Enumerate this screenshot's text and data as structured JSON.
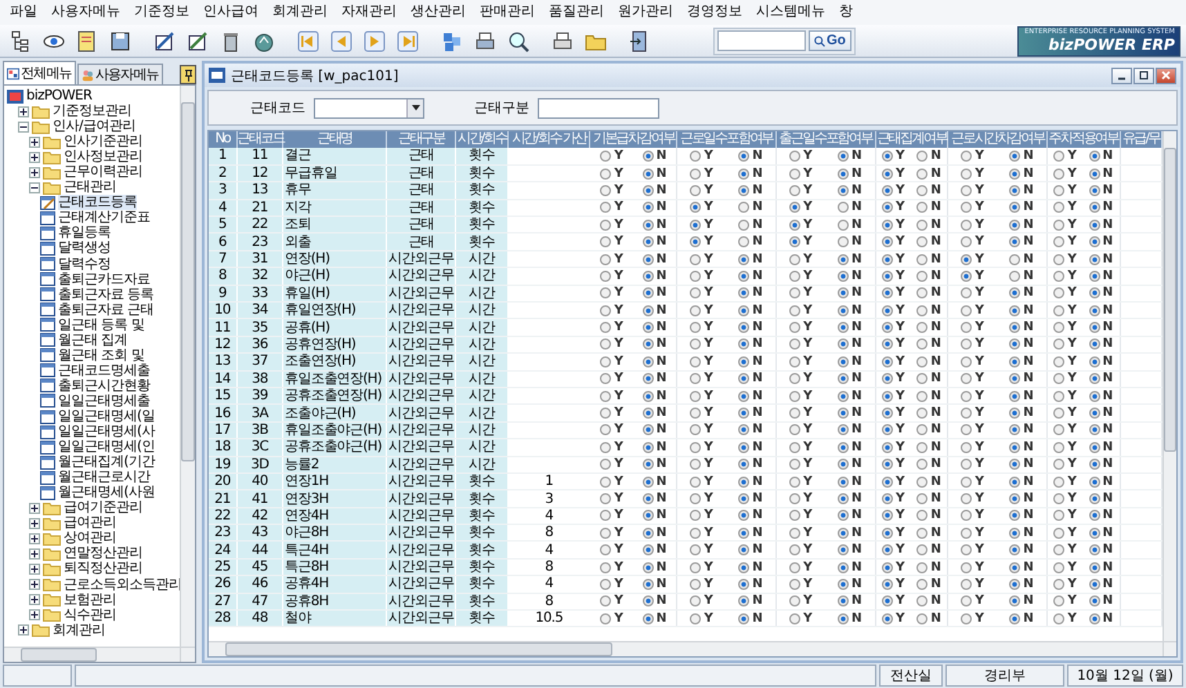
{
  "menu_bar": [
    "파일",
    "사용자메뉴",
    "기준정보",
    "인사급여",
    "회계관리",
    "자재관리",
    "생산관리",
    "판매관리",
    "품질관리",
    "원가관리",
    "경영정보",
    "시스템메뉴",
    "창"
  ],
  "toolbar": {
    "search": {
      "button": "Go"
    },
    "logo": {
      "tagline": "ENTERPRISE RESOURCE PLANNING SYSTEM",
      "name": "bizPOWER ERP"
    }
  },
  "sidebar": {
    "tabs": [
      {
        "label": "전체메뉴",
        "selected": true
      },
      {
        "label": "사용자메뉴",
        "selected": false
      }
    ],
    "tree": [
      {
        "label": "bizPOWER",
        "kind": "root",
        "selected": false,
        "children": [
          {
            "label": "기준정보관리",
            "kind": "folder",
            "expanded": false,
            "selected": false
          },
          {
            "label": "인사/급여관리",
            "kind": "folder",
            "expanded": true,
            "selected": false,
            "children": [
              {
                "label": "인사기준관리",
                "kind": "folder",
                "expanded": false,
                "selected": false
              },
              {
                "label": "인사정보관리",
                "kind": "folder",
                "expanded": false,
                "selected": false
              },
              {
                "label": "근무이력관리",
                "kind": "folder",
                "expanded": false,
                "selected": false
              },
              {
                "label": "근태관리",
                "kind": "folder",
                "expanded": true,
                "selected": false,
                "children": [
                  {
                    "label": "근태코드등록",
                    "kind": "form-edit",
                    "selected": true
                  },
                  {
                    "label": "근태계산기준표",
                    "kind": "form",
                    "selected": false
                  },
                  {
                    "label": "휴일등록",
                    "kind": "form",
                    "selected": false
                  },
                  {
                    "label": "달력생성",
                    "kind": "form",
                    "selected": false
                  },
                  {
                    "label": "달력수정",
                    "kind": "form",
                    "selected": false
                  },
                  {
                    "label": "출퇴근카드자료",
                    "kind": "form",
                    "selected": false
                  },
                  {
                    "label": "출퇴근자료 등록",
                    "kind": "form",
                    "selected": false
                  },
                  {
                    "label": "출퇴근자료 근태",
                    "kind": "form",
                    "selected": false
                  },
                  {
                    "label": "일근태 등록 및",
                    "kind": "form",
                    "selected": false
                  },
                  {
                    "label": "월근태 집계",
                    "kind": "form",
                    "selected": false
                  },
                  {
                    "label": "월근태 조회 및",
                    "kind": "form",
                    "selected": false
                  },
                  {
                    "label": "근태코드명세출",
                    "kind": "form",
                    "selected": false
                  },
                  {
                    "label": "출퇴근시간현황",
                    "kind": "form",
                    "selected": false
                  },
                  {
                    "label": "일일근태명세출",
                    "kind": "form",
                    "selected": false
                  },
                  {
                    "label": "일일근태명세(일",
                    "kind": "form",
                    "selected": false
                  },
                  {
                    "label": "일일근태명세(사",
                    "kind": "form",
                    "selected": false
                  },
                  {
                    "label": "일일근태명세(인",
                    "kind": "form",
                    "selected": false
                  },
                  {
                    "label": "월근태집계(기간",
                    "kind": "form",
                    "selected": false
                  },
                  {
                    "label": "월근태근로시간",
                    "kind": "form",
                    "selected": false
                  },
                  {
                    "label": "월근태명세(사원",
                    "kind": "form",
                    "selected": false
                  }
                ]
              },
              {
                "label": "급여기준관리",
                "kind": "folder",
                "expanded": false,
                "selected": false
              },
              {
                "label": "급여관리",
                "kind": "folder",
                "expanded": false,
                "selected": false
              },
              {
                "label": "상여관리",
                "kind": "folder",
                "expanded": false,
                "selected": false
              },
              {
                "label": "연말정산관리",
                "kind": "folder",
                "expanded": false,
                "selected": false
              },
              {
                "label": "퇴직정산관리",
                "kind": "folder",
                "expanded": false,
                "selected": false
              },
              {
                "label": "근로소득외소득관리",
                "kind": "folder",
                "expanded": false,
                "selected": false
              },
              {
                "label": "보험관리",
                "kind": "folder",
                "expanded": false,
                "selected": false
              },
              {
                "label": "식수관리",
                "kind": "folder",
                "expanded": false,
                "selected": false
              }
            ]
          },
          {
            "label": "회계관리",
            "kind": "folder",
            "expanded": false,
            "selected": false
          }
        ]
      }
    ]
  },
  "window": {
    "title": "근태코드등록 [w_pac101]",
    "filters": [
      {
        "label": "근태코드",
        "kind": "dropdown"
      },
      {
        "label": "근태구분",
        "kind": "text"
      }
    ],
    "table": {
      "columns": [
        "No",
        "근태코드",
        "근태명",
        "근태구분",
        "시간/회수",
        "시간/회수 가산",
        "기본급차감여부",
        "근로일수포함여부",
        "출근일수포함여부",
        "근태집계여부",
        "근로시간차감여부",
        "주차적용여부",
        "유급/무"
      ],
      "rows": [
        {
          "no": "1",
          "code": "11",
          "name": "결근",
          "type": "근태",
          "unit": "횟수",
          "add": "",
          "flags": [
            {
              "y": "Y",
              "n": "N",
              "selected_y": false
            },
            {
              "y": "Y",
              "n": "N",
              "selected_y": false
            },
            {
              "y": "Y",
              "n": "N",
              "selected_y": false
            },
            {
              "y": "Y",
              "n": "N",
              "selected_y": true
            },
            {
              "y": "Y",
              "n": "N",
              "selected_y": false
            },
            {
              "y": "Y",
              "n": "N",
              "selected_y": false
            }
          ]
        },
        {
          "no": "2",
          "code": "12",
          "name": "무급휴일",
          "type": "근태",
          "unit": "횟수",
          "add": "",
          "flags": [
            {
              "y": "Y",
              "n": "N",
              "selected_y": false
            },
            {
              "y": "Y",
              "n": "N",
              "selected_y": false
            },
            {
              "y": "Y",
              "n": "N",
              "selected_y": false
            },
            {
              "y": "Y",
              "n": "N",
              "selected_y": true
            },
            {
              "y": "Y",
              "n": "N",
              "selected_y": false
            },
            {
              "y": "Y",
              "n": "N",
              "selected_y": false
            }
          ]
        },
        {
          "no": "3",
          "code": "13",
          "name": "휴무",
          "type": "근태",
          "unit": "횟수",
          "add": "",
          "flags": [
            {
              "y": "Y",
              "n": "N",
              "selected_y": false
            },
            {
              "y": "Y",
              "n": "N",
              "selected_y": false
            },
            {
              "y": "Y",
              "n": "N",
              "selected_y": false
            },
            {
              "y": "Y",
              "n": "N",
              "selected_y": true
            },
            {
              "y": "Y",
              "n": "N",
              "selected_y": false
            },
            {
              "y": "Y",
              "n": "N",
              "selected_y": false
            }
          ]
        },
        {
          "no": "4",
          "code": "21",
          "name": "지각",
          "type": "근태",
          "unit": "횟수",
          "add": "",
          "flags": [
            {
              "y": "Y",
              "n": "N",
              "selected_y": false
            },
            {
              "y": "Y",
              "n": "N",
              "selected_y": true
            },
            {
              "y": "Y",
              "n": "N",
              "selected_y": true
            },
            {
              "y": "Y",
              "n": "N",
              "selected_y": true
            },
            {
              "y": "Y",
              "n": "N",
              "selected_y": false
            },
            {
              "y": "Y",
              "n": "N",
              "selected_y": false
            }
          ]
        },
        {
          "no": "5",
          "code": "22",
          "name": "조퇴",
          "type": "근태",
          "unit": "횟수",
          "add": "",
          "flags": [
            {
              "y": "Y",
              "n": "N",
              "selected_y": false
            },
            {
              "y": "Y",
              "n": "N",
              "selected_y": true
            },
            {
              "y": "Y",
              "n": "N",
              "selected_y": true
            },
            {
              "y": "Y",
              "n": "N",
              "selected_y": true
            },
            {
              "y": "Y",
              "n": "N",
              "selected_y": false
            },
            {
              "y": "Y",
              "n": "N",
              "selected_y": false
            }
          ]
        },
        {
          "no": "6",
          "code": "23",
          "name": "외출",
          "type": "근태",
          "unit": "횟수",
          "add": "",
          "flags": [
            {
              "y": "Y",
              "n": "N",
              "selected_y": false
            },
            {
              "y": "Y",
              "n": "N",
              "selected_y": true
            },
            {
              "y": "Y",
              "n": "N",
              "selected_y": true
            },
            {
              "y": "Y",
              "n": "N",
              "selected_y": true
            },
            {
              "y": "Y",
              "n": "N",
              "selected_y": false
            },
            {
              "y": "Y",
              "n": "N",
              "selected_y": false
            }
          ]
        },
        {
          "no": "7",
          "code": "31",
          "name": "연장(H)",
          "type": "시간외근무",
          "unit": "시간",
          "add": "",
          "flags": [
            {
              "y": "Y",
              "n": "N",
              "selected_y": false
            },
            {
              "y": "Y",
              "n": "N",
              "selected_y": false
            },
            {
              "y": "Y",
              "n": "N",
              "selected_y": false
            },
            {
              "y": "Y",
              "n": "N",
              "selected_y": true
            },
            {
              "y": "Y",
              "n": "N",
              "selected_y": true
            },
            {
              "y": "Y",
              "n": "N",
              "selected_y": false
            }
          ]
        },
        {
          "no": "8",
          "code": "32",
          "name": "야근(H)",
          "type": "시간외근무",
          "unit": "시간",
          "add": "",
          "flags": [
            {
              "y": "Y",
              "n": "N",
              "selected_y": false
            },
            {
              "y": "Y",
              "n": "N",
              "selected_y": false
            },
            {
              "y": "Y",
              "n": "N",
              "selected_y": false
            },
            {
              "y": "Y",
              "n": "N",
              "selected_y": true
            },
            {
              "y": "Y",
              "n": "N",
              "selected_y": true
            },
            {
              "y": "Y",
              "n": "N",
              "selected_y": false
            }
          ]
        },
        {
          "no": "9",
          "code": "33",
          "name": "휴일(H)",
          "type": "시간외근무",
          "unit": "시간",
          "add": "",
          "flags": [
            {
              "y": "Y",
              "n": "N",
              "selected_y": false
            },
            {
              "y": "Y",
              "n": "N",
              "selected_y": false
            },
            {
              "y": "Y",
              "n": "N",
              "selected_y": false
            },
            {
              "y": "Y",
              "n": "N",
              "selected_y": true
            },
            {
              "y": "Y",
              "n": "N",
              "selected_y": false
            },
            {
              "y": "Y",
              "n": "N",
              "selected_y": false
            }
          ]
        },
        {
          "no": "10",
          "code": "34",
          "name": "휴일연장(H)",
          "type": "시간외근무",
          "unit": "시간",
          "add": "",
          "flags": [
            {
              "y": "Y",
              "n": "N",
              "selected_y": false
            },
            {
              "y": "Y",
              "n": "N",
              "selected_y": false
            },
            {
              "y": "Y",
              "n": "N",
              "selected_y": false
            },
            {
              "y": "Y",
              "n": "N",
              "selected_y": true
            },
            {
              "y": "Y",
              "n": "N",
              "selected_y": false
            },
            {
              "y": "Y",
              "n": "N",
              "selected_y": false
            }
          ]
        },
        {
          "no": "11",
          "code": "35",
          "name": "공휴(H)",
          "type": "시간외근무",
          "unit": "시간",
          "add": "",
          "flags": [
            {
              "y": "Y",
              "n": "N",
              "selected_y": false
            },
            {
              "y": "Y",
              "n": "N",
              "selected_y": false
            },
            {
              "y": "Y",
              "n": "N",
              "selected_y": false
            },
            {
              "y": "Y",
              "n": "N",
              "selected_y": true
            },
            {
              "y": "Y",
              "n": "N",
              "selected_y": false
            },
            {
              "y": "Y",
              "n": "N",
              "selected_y": false
            }
          ]
        },
        {
          "no": "12",
          "code": "36",
          "name": "공휴연장(H)",
          "type": "시간외근무",
          "unit": "시간",
          "add": "",
          "flags": [
            {
              "y": "Y",
              "n": "N",
              "selected_y": false
            },
            {
              "y": "Y",
              "n": "N",
              "selected_y": false
            },
            {
              "y": "Y",
              "n": "N",
              "selected_y": false
            },
            {
              "y": "Y",
              "n": "N",
              "selected_y": true
            },
            {
              "y": "Y",
              "n": "N",
              "selected_y": false
            },
            {
              "y": "Y",
              "n": "N",
              "selected_y": false
            }
          ]
        },
        {
          "no": "13",
          "code": "37",
          "name": "조출연장(H)",
          "type": "시간외근무",
          "unit": "시간",
          "add": "",
          "flags": [
            {
              "y": "Y",
              "n": "N",
              "selected_y": false
            },
            {
              "y": "Y",
              "n": "N",
              "selected_y": false
            },
            {
              "y": "Y",
              "n": "N",
              "selected_y": false
            },
            {
              "y": "Y",
              "n": "N",
              "selected_y": true
            },
            {
              "y": "Y",
              "n": "N",
              "selected_y": false
            },
            {
              "y": "Y",
              "n": "N",
              "selected_y": false
            }
          ]
        },
        {
          "no": "14",
          "code": "38",
          "name": "휴일조출연장(H)",
          "type": "시간외근무",
          "unit": "시간",
          "add": "",
          "flags": [
            {
              "y": "Y",
              "n": "N",
              "selected_y": false
            },
            {
              "y": "Y",
              "n": "N",
              "selected_y": false
            },
            {
              "y": "Y",
              "n": "N",
              "selected_y": false
            },
            {
              "y": "Y",
              "n": "N",
              "selected_y": true
            },
            {
              "y": "Y",
              "n": "N",
              "selected_y": false
            },
            {
              "y": "Y",
              "n": "N",
              "selected_y": false
            }
          ]
        },
        {
          "no": "15",
          "code": "39",
          "name": "공휴조출연장(H)",
          "type": "시간외근무",
          "unit": "시간",
          "add": "",
          "flags": [
            {
              "y": "Y",
              "n": "N",
              "selected_y": false
            },
            {
              "y": "Y",
              "n": "N",
              "selected_y": false
            },
            {
              "y": "Y",
              "n": "N",
              "selected_y": false
            },
            {
              "y": "Y",
              "n": "N",
              "selected_y": true
            },
            {
              "y": "Y",
              "n": "N",
              "selected_y": false
            },
            {
              "y": "Y",
              "n": "N",
              "selected_y": false
            }
          ]
        },
        {
          "no": "16",
          "code": "3A",
          "name": "조출야근(H)",
          "type": "시간외근무",
          "unit": "시간",
          "add": "",
          "flags": [
            {
              "y": "Y",
              "n": "N",
              "selected_y": false
            },
            {
              "y": "Y",
              "n": "N",
              "selected_y": false
            },
            {
              "y": "Y",
              "n": "N",
              "selected_y": false
            },
            {
              "y": "Y",
              "n": "N",
              "selected_y": true
            },
            {
              "y": "Y",
              "n": "N",
              "selected_y": false
            },
            {
              "y": "Y",
              "n": "N",
              "selected_y": false
            }
          ]
        },
        {
          "no": "17",
          "code": "3B",
          "name": "휴일조출야근(H)",
          "type": "시간외근무",
          "unit": "시간",
          "add": "",
          "flags": [
            {
              "y": "Y",
              "n": "N",
              "selected_y": false
            },
            {
              "y": "Y",
              "n": "N",
              "selected_y": false
            },
            {
              "y": "Y",
              "n": "N",
              "selected_y": false
            },
            {
              "y": "Y",
              "n": "N",
              "selected_y": true
            },
            {
              "y": "Y",
              "n": "N",
              "selected_y": false
            },
            {
              "y": "Y",
              "n": "N",
              "selected_y": false
            }
          ]
        },
        {
          "no": "18",
          "code": "3C",
          "name": "공휴조출야근(H)",
          "type": "시간외근무",
          "unit": "시간",
          "add": "",
          "flags": [
            {
              "y": "Y",
              "n": "N",
              "selected_y": false
            },
            {
              "y": "Y",
              "n": "N",
              "selected_y": false
            },
            {
              "y": "Y",
              "n": "N",
              "selected_y": false
            },
            {
              "y": "Y",
              "n": "N",
              "selected_y": true
            },
            {
              "y": "Y",
              "n": "N",
              "selected_y": false
            },
            {
              "y": "Y",
              "n": "N",
              "selected_y": false
            }
          ]
        },
        {
          "no": "19",
          "code": "3D",
          "name": "능률2",
          "type": "시간외근무",
          "unit": "시간",
          "add": "",
          "flags": [
            {
              "y": "Y",
              "n": "N",
              "selected_y": false
            },
            {
              "y": "Y",
              "n": "N",
              "selected_y": false
            },
            {
              "y": "Y",
              "n": "N",
              "selected_y": false
            },
            {
              "y": "Y",
              "n": "N",
              "selected_y": true
            },
            {
              "y": "Y",
              "n": "N",
              "selected_y": false
            },
            {
              "y": "Y",
              "n": "N",
              "selected_y": false
            }
          ]
        },
        {
          "no": "20",
          "code": "40",
          "name": "연장1H",
          "type": "시간외근무",
          "unit": "횟수",
          "add": "1",
          "flags": [
            {
              "y": "Y",
              "n": "N",
              "selected_y": false
            },
            {
              "y": "Y",
              "n": "N",
              "selected_y": false
            },
            {
              "y": "Y",
              "n": "N",
              "selected_y": false
            },
            {
              "y": "Y",
              "n": "N",
              "selected_y": true
            },
            {
              "y": "Y",
              "n": "N",
              "selected_y": false
            },
            {
              "y": "Y",
              "n": "N",
              "selected_y": false
            }
          ]
        },
        {
          "no": "21",
          "code": "41",
          "name": "연장3H",
          "type": "시간외근무",
          "unit": "횟수",
          "add": "3",
          "flags": [
            {
              "y": "Y",
              "n": "N",
              "selected_y": false
            },
            {
              "y": "Y",
              "n": "N",
              "selected_y": false
            },
            {
              "y": "Y",
              "n": "N",
              "selected_y": false
            },
            {
              "y": "Y",
              "n": "N",
              "selected_y": true
            },
            {
              "y": "Y",
              "n": "N",
              "selected_y": false
            },
            {
              "y": "Y",
              "n": "N",
              "selected_y": false
            }
          ]
        },
        {
          "no": "22",
          "code": "42",
          "name": "연장4H",
          "type": "시간외근무",
          "unit": "횟수",
          "add": "4",
          "flags": [
            {
              "y": "Y",
              "n": "N",
              "selected_y": false
            },
            {
              "y": "Y",
              "n": "N",
              "selected_y": false
            },
            {
              "y": "Y",
              "n": "N",
              "selected_y": false
            },
            {
              "y": "Y",
              "n": "N",
              "selected_y": true
            },
            {
              "y": "Y",
              "n": "N",
              "selected_y": false
            },
            {
              "y": "Y",
              "n": "N",
              "selected_y": false
            }
          ]
        },
        {
          "no": "23",
          "code": "43",
          "name": "야근8H",
          "type": "시간외근무",
          "unit": "횟수",
          "add": "8",
          "flags": [
            {
              "y": "Y",
              "n": "N",
              "selected_y": false
            },
            {
              "y": "Y",
              "n": "N",
              "selected_y": false
            },
            {
              "y": "Y",
              "n": "N",
              "selected_y": false
            },
            {
              "y": "Y",
              "n": "N",
              "selected_y": true
            },
            {
              "y": "Y",
              "n": "N",
              "selected_y": false
            },
            {
              "y": "Y",
              "n": "N",
              "selected_y": false
            }
          ]
        },
        {
          "no": "24",
          "code": "44",
          "name": "특근4H",
          "type": "시간외근무",
          "unit": "횟수",
          "add": "4",
          "flags": [
            {
              "y": "Y",
              "n": "N",
              "selected_y": false
            },
            {
              "y": "Y",
              "n": "N",
              "selected_y": false
            },
            {
              "y": "Y",
              "n": "N",
              "selected_y": false
            },
            {
              "y": "Y",
              "n": "N",
              "selected_y": true
            },
            {
              "y": "Y",
              "n": "N",
              "selected_y": false
            },
            {
              "y": "Y",
              "n": "N",
              "selected_y": false
            }
          ]
        },
        {
          "no": "25",
          "code": "45",
          "name": "특근8H",
          "type": "시간외근무",
          "unit": "횟수",
          "add": "8",
          "flags": [
            {
              "y": "Y",
              "n": "N",
              "selected_y": false
            },
            {
              "y": "Y",
              "n": "N",
              "selected_y": false
            },
            {
              "y": "Y",
              "n": "N",
              "selected_y": false
            },
            {
              "y": "Y",
              "n": "N",
              "selected_y": true
            },
            {
              "y": "Y",
              "n": "N",
              "selected_y": false
            },
            {
              "y": "Y",
              "n": "N",
              "selected_y": false
            }
          ]
        },
        {
          "no": "26",
          "code": "46",
          "name": "공휴4H",
          "type": "시간외근무",
          "unit": "횟수",
          "add": "4",
          "flags": [
            {
              "y": "Y",
              "n": "N",
              "selected_y": false
            },
            {
              "y": "Y",
              "n": "N",
              "selected_y": false
            },
            {
              "y": "Y",
              "n": "N",
              "selected_y": false
            },
            {
              "y": "Y",
              "n": "N",
              "selected_y": true
            },
            {
              "y": "Y",
              "n": "N",
              "selected_y": false
            },
            {
              "y": "Y",
              "n": "N",
              "selected_y": false
            }
          ]
        },
        {
          "no": "27",
          "code": "47",
          "name": "공휴8H",
          "type": "시간외근무",
          "unit": "횟수",
          "add": "8",
          "flags": [
            {
              "y": "Y",
              "n": "N",
              "selected_y": false
            },
            {
              "y": "Y",
              "n": "N",
              "selected_y": false
            },
            {
              "y": "Y",
              "n": "N",
              "selected_y": false
            },
            {
              "y": "Y",
              "n": "N",
              "selected_y": true
            },
            {
              "y": "Y",
              "n": "N",
              "selected_y": false
            },
            {
              "y": "Y",
              "n": "N",
              "selected_y": false
            }
          ]
        },
        {
          "no": "28",
          "code": "48",
          "name": "철야",
          "type": "시간외근무",
          "unit": "횟수",
          "add": "10.5",
          "flags": [
            {
              "y": "Y",
              "n": "N",
              "selected_y": false
            },
            {
              "y": "Y",
              "n": "N",
              "selected_y": false
            },
            {
              "y": "Y",
              "n": "N",
              "selected_y": false
            },
            {
              "y": "Y",
              "n": "N",
              "selected_y": true
            },
            {
              "y": "Y",
              "n": "N",
              "selected_y": false
            },
            {
              "y": "Y",
              "n": "N",
              "selected_y": false
            }
          ]
        }
      ]
    }
  },
  "status_bar": [
    "전산실",
    "경리부",
    "10월 12일 (월)"
  ]
}
